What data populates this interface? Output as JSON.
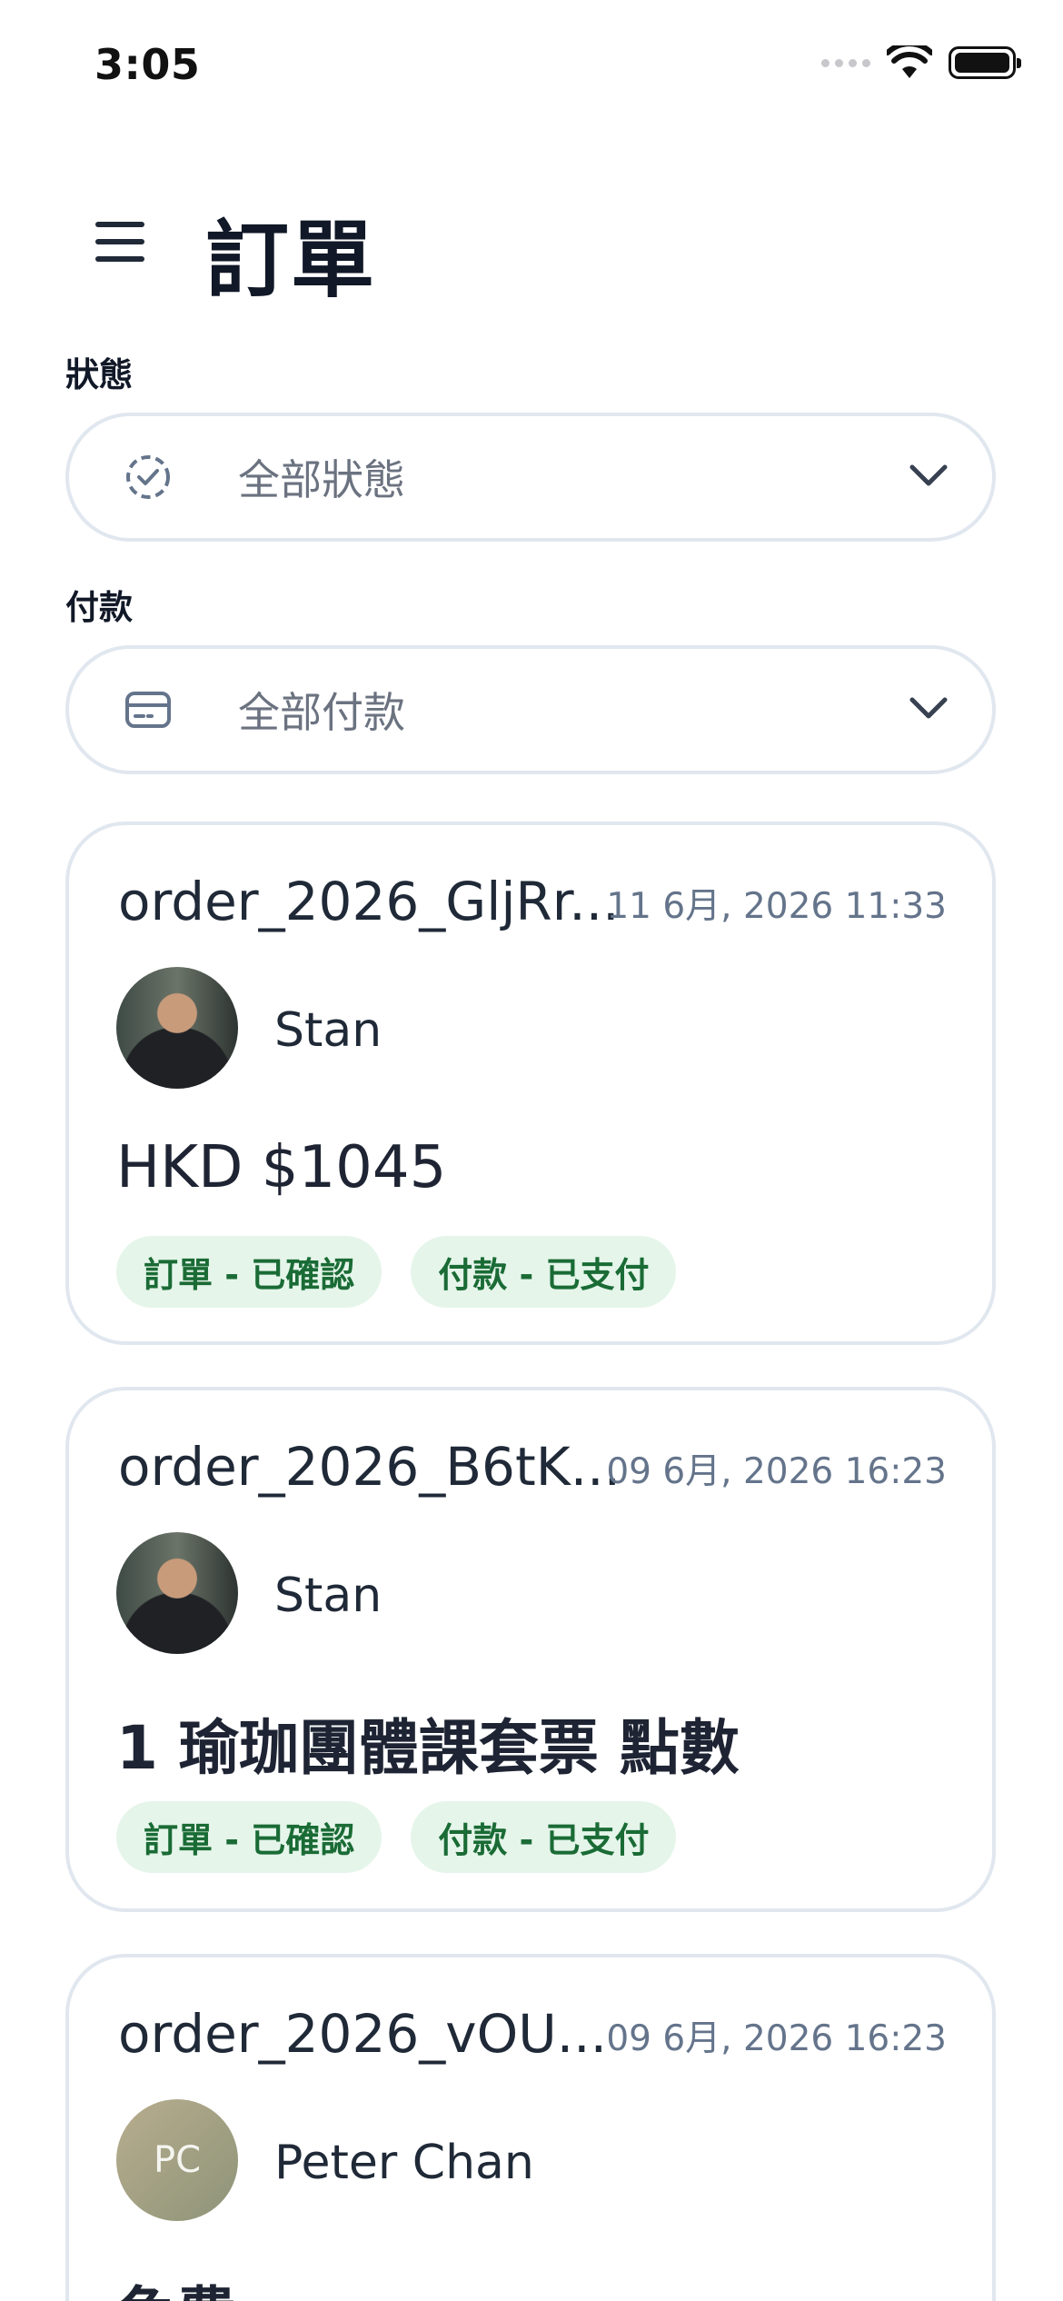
{
  "status_bar": {
    "time": "3:05"
  },
  "header": {
    "title": "訂單"
  },
  "filters": {
    "status": {
      "label": "狀態",
      "value": "全部狀態"
    },
    "payment": {
      "label": "付款",
      "value": "全部付款"
    }
  },
  "orders": [
    {
      "id": "order_2026_GljRr...",
      "date": "11 6月, 2026 11:33",
      "customer": "Stan",
      "amount": "HKD $1045",
      "badges": [
        "訂單 - 已確認",
        "付款 - 已支付"
      ]
    },
    {
      "id": "order_2026_B6tK...",
      "date": "09 6月, 2026 16:23",
      "customer": "Stan",
      "amount": "1 瑜珈團體課套票 點數",
      "badges": [
        "訂單 - 已確認",
        "付款 - 已支付"
      ]
    },
    {
      "id": "order_2026_vOU...",
      "date": "09 6月, 2026 16:23",
      "customer": "Peter Chan",
      "initials": "PC",
      "amount": "免費"
    }
  ],
  "colors": {
    "badge_bg": "#e5f5ea",
    "badge_text": "#1a6b35",
    "border": "#e1e7ef",
    "muted": "#64748b"
  }
}
